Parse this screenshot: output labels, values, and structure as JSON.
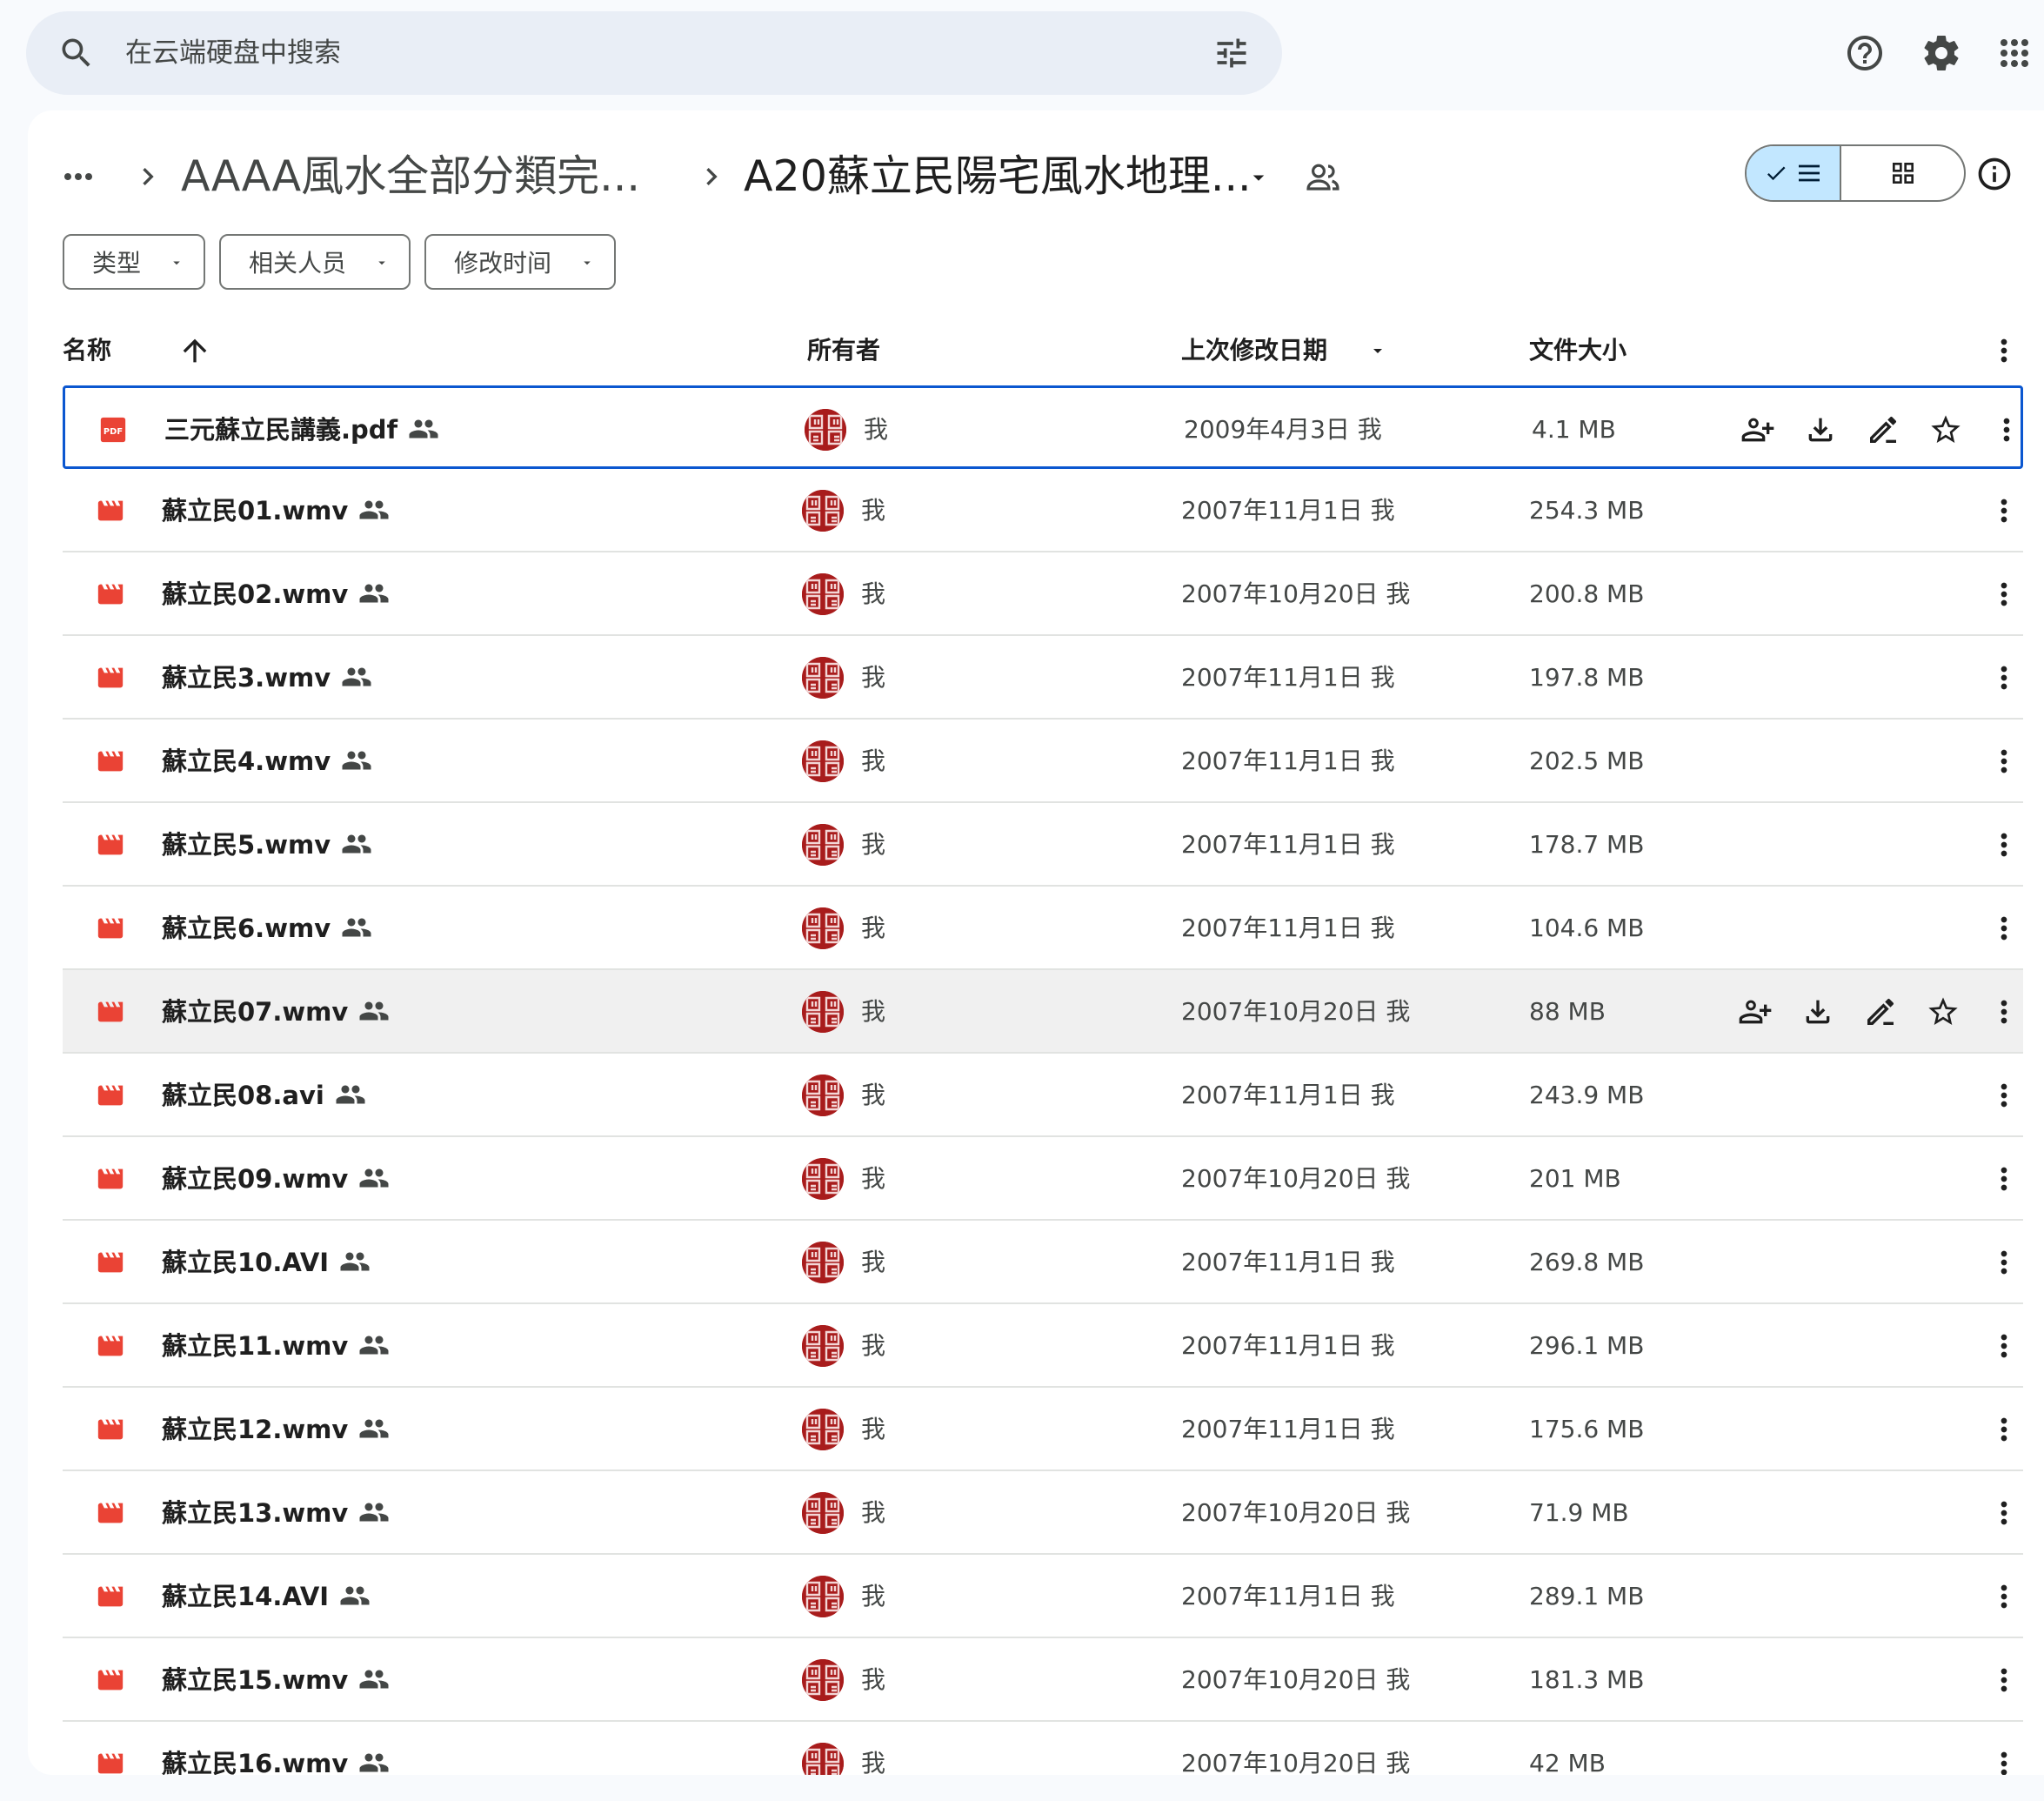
{
  "search": {
    "placeholder": "在云端硬盘中搜索"
  },
  "topbar": {
    "icons": [
      "help-icon",
      "settings-icon",
      "apps-icon"
    ]
  },
  "breadcrumb": {
    "more": "more-horiz-icon",
    "items": [
      {
        "label": "AAAA風水全部分類完..."
      },
      {
        "label": "A20蘇立民陽宅風水地理..."
      }
    ]
  },
  "view": {
    "active": "list",
    "options": [
      "list",
      "grid"
    ]
  },
  "filters": [
    {
      "label": "类型"
    },
    {
      "label": "相关人员"
    },
    {
      "label": "修改时间"
    }
  ],
  "table": {
    "columns": {
      "name": "名称",
      "owner": "所有者",
      "modified": "上次修改日期",
      "size": "文件大小"
    },
    "sort": {
      "column": "name",
      "direction": "ascending"
    },
    "accent": "#d93025",
    "rows": [
      {
        "name": "三元蘇立民講義.pdf",
        "type": "pdf",
        "owner": "我",
        "modified": "2009年4月3日 我",
        "size": "4.1 MB",
        "state": "selected"
      },
      {
        "name": "蘇立民01.wmv",
        "type": "video",
        "owner": "我",
        "modified": "2007年11月1日 我",
        "size": "254.3 MB"
      },
      {
        "name": "蘇立民02.wmv",
        "type": "video",
        "owner": "我",
        "modified": "2007年10月20日 我",
        "size": "200.8 MB"
      },
      {
        "name": "蘇立民3.wmv",
        "type": "video",
        "owner": "我",
        "modified": "2007年11月1日 我",
        "size": "197.8 MB"
      },
      {
        "name": "蘇立民4.wmv",
        "type": "video",
        "owner": "我",
        "modified": "2007年11月1日 我",
        "size": "202.5 MB"
      },
      {
        "name": "蘇立民5.wmv",
        "type": "video",
        "owner": "我",
        "modified": "2007年11月1日 我",
        "size": "178.7 MB"
      },
      {
        "name": "蘇立民6.wmv",
        "type": "video",
        "owner": "我",
        "modified": "2007年11月1日 我",
        "size": "104.6 MB"
      },
      {
        "name": "蘇立民07.wmv",
        "type": "video",
        "owner": "我",
        "modified": "2007年10月20日 我",
        "size": "88 MB",
        "state": "hover"
      },
      {
        "name": "蘇立民08.avi",
        "type": "video",
        "owner": "我",
        "modified": "2007年11月1日 我",
        "size": "243.9 MB"
      },
      {
        "name": "蘇立民09.wmv",
        "type": "video",
        "owner": "我",
        "modified": "2007年10月20日 我",
        "size": "201 MB"
      },
      {
        "name": "蘇立民10.AVI",
        "type": "video",
        "owner": "我",
        "modified": "2007年11月1日 我",
        "size": "269.8 MB"
      },
      {
        "name": "蘇立民11.wmv",
        "type": "video",
        "owner": "我",
        "modified": "2007年11月1日 我",
        "size": "296.1 MB"
      },
      {
        "name": "蘇立民12.wmv",
        "type": "video",
        "owner": "我",
        "modified": "2007年11月1日 我",
        "size": "175.6 MB"
      },
      {
        "name": "蘇立民13.wmv",
        "type": "video",
        "owner": "我",
        "modified": "2007年10月20日 我",
        "size": "71.9 MB"
      },
      {
        "name": "蘇立民14.AVI",
        "type": "video",
        "owner": "我",
        "modified": "2007年11月1日 我",
        "size": "289.1 MB"
      },
      {
        "name": "蘇立民15.wmv",
        "type": "video",
        "owner": "我",
        "modified": "2007年10月20日 我",
        "size": "181.3 MB"
      },
      {
        "name": "蘇立民16.wmv",
        "type": "video",
        "owner": "我",
        "modified": "2007年10月20日 我",
        "size": "42 MB"
      }
    ]
  }
}
